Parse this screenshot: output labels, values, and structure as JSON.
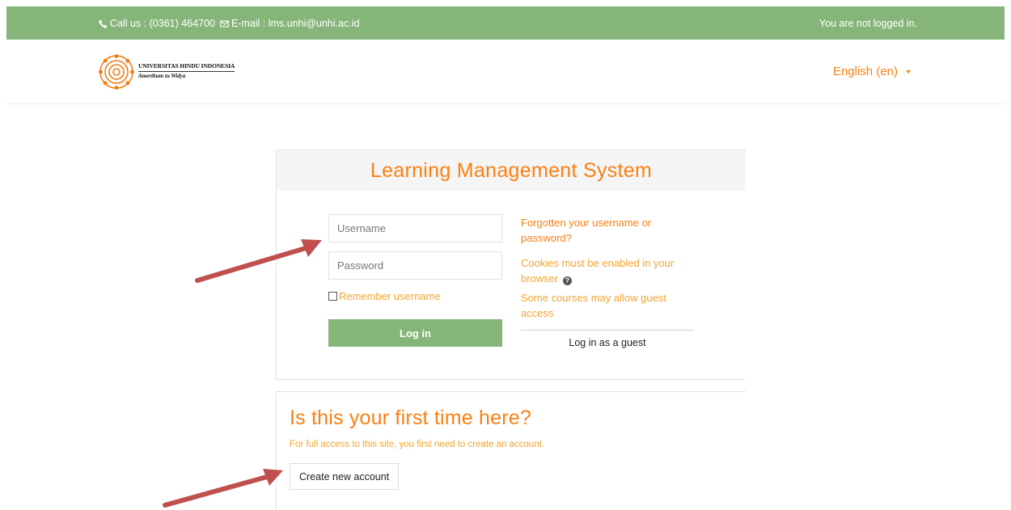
{
  "topbar": {
    "contact_text": "Call us : (0361) 464700",
    "email_text": "E-mail : lms.unhi@unhi.ac.id",
    "login_status": "You are not logged in."
  },
  "header": {
    "logo_univ": "UNIVERSITAS HINDU INDONESIA",
    "logo_motto": "Amerthum tu Widya",
    "language": "English (en)"
  },
  "login": {
    "title": "Learning Management System",
    "username_placeholder": "Username",
    "password_placeholder": "Password",
    "remember_label": "Remember username",
    "login_button": "Log in",
    "forgot_link": "Forgotten your username or password?",
    "cookies_notice": "Cookies must be enabled in your browser",
    "guest_notice": "Some courses may allow guest access",
    "guest_button": "Log in as a guest"
  },
  "signup": {
    "title": "Is this your first time here?",
    "description": "For full access to this site, you first need to create an account.",
    "create_button": "Create new account"
  },
  "colors": {
    "topbar": "#86b57a",
    "accent": "#f98012",
    "muted_accent": "#f0a530",
    "arrow": "#c0504d"
  }
}
